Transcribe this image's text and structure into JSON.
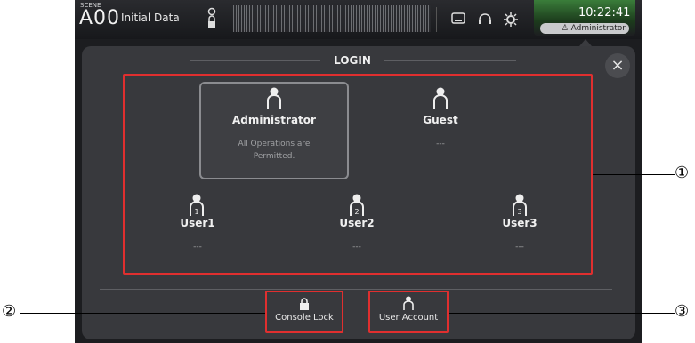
{
  "header": {
    "scene_label": "SCENE",
    "scene_number": "A00",
    "scene_name": "Initial Data",
    "time": "10:22:41",
    "current_user": "Administrator"
  },
  "dialog": {
    "title": "LOGIN",
    "accounts": [
      {
        "name": "Administrator",
        "desc": "All Operations are Permitted.",
        "selected": true
      },
      {
        "name": "Guest",
        "desc": "---"
      },
      {
        "name": "User1",
        "badge": "1",
        "desc": "---"
      },
      {
        "name": "User2",
        "badge": "2",
        "desc": "---"
      },
      {
        "name": "User3",
        "badge": "3",
        "desc": "---"
      }
    ],
    "buttons": {
      "console_lock": "Console Lock",
      "user_account": "User Account"
    }
  },
  "callouts": {
    "one": "①",
    "two": "②",
    "three": "③"
  },
  "colors": {
    "accent_red": "#e02f2f",
    "clock_green": "#3a7d3a",
    "panel": "#38393d"
  }
}
